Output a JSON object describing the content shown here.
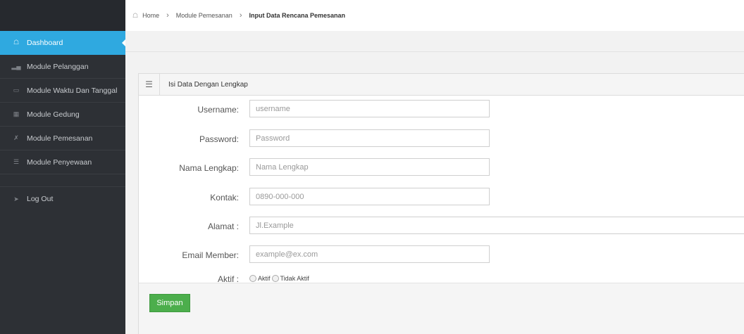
{
  "sidebar": {
    "items": [
      {
        "label": "Dashboard",
        "icon": "home-icon"
      },
      {
        "label": "Module Pelanggan",
        "icon": "bar-chart-icon"
      },
      {
        "label": "Module Waktu Dan Tanggal",
        "icon": "desktop-icon"
      },
      {
        "label": "Module Gedung",
        "icon": "grid-icon"
      },
      {
        "label": "Module Pemesanan",
        "icon": "fullscreen-icon"
      },
      {
        "label": "Module Penyewaan",
        "icon": "list-icon"
      }
    ],
    "logout": {
      "label": "Log Out",
      "icon": "sign-out-icon"
    },
    "colors": {
      "background": "#2d3035",
      "active": "#2fa9e0"
    }
  },
  "breadcrumb": {
    "home": "Home",
    "module": "Module Pemesanan",
    "current": "Input Data Rencana Pemesanan"
  },
  "panel": {
    "title": "Isi Data Dengan Lengkap",
    "icon": "menu-icon"
  },
  "form": {
    "username": {
      "label": "Username:",
      "placeholder": "username"
    },
    "password": {
      "label": "Password:",
      "placeholder": "Password"
    },
    "nama": {
      "label": "Nama Lengkap:",
      "placeholder": "Nama Lengkap"
    },
    "kontak": {
      "label": "Kontak:",
      "placeholder": "0890-000-000"
    },
    "alamat": {
      "label": "Alamat :",
      "placeholder": "Jl.Example"
    },
    "email": {
      "label": "Email Member:",
      "placeholder": "example@ex.com"
    },
    "aktif": {
      "label": "Aktif :",
      "options": [
        "Aktif",
        "Tidak Aktif"
      ]
    }
  },
  "actions": {
    "save_label": "Simpan",
    "save_color": "#4cae4c"
  }
}
